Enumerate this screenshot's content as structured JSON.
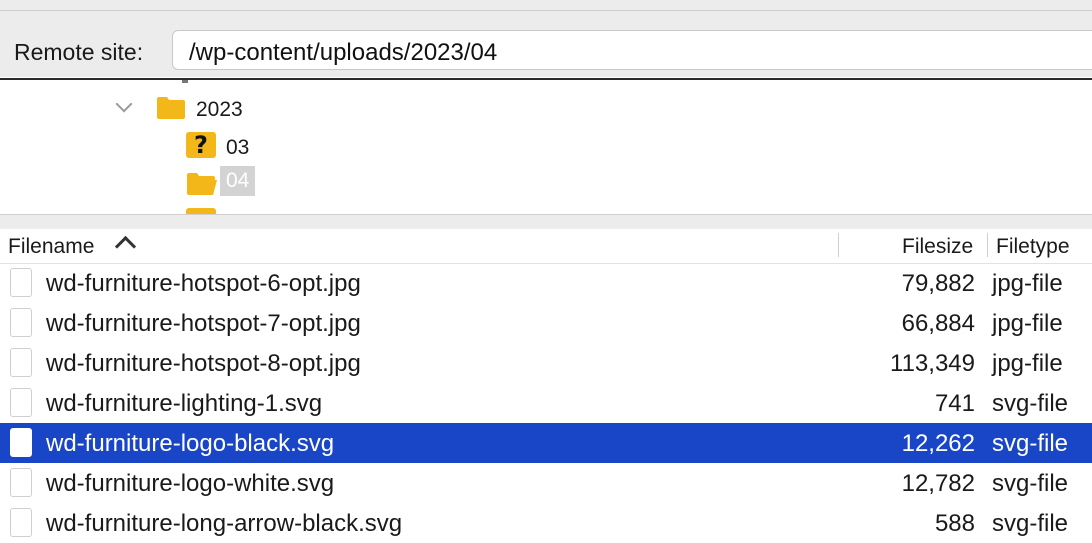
{
  "remote_site": {
    "label": "Remote site:",
    "path": "/wp-content/uploads/2023/04"
  },
  "tree": {
    "items": [
      {
        "label": "2023",
        "icon": "folder-icon",
        "expanded": true
      },
      {
        "label": "03",
        "icon": "unknown-folder-icon"
      },
      {
        "label": "04",
        "icon": "open-folder-icon",
        "selected": true
      }
    ]
  },
  "file_list": {
    "headers": {
      "filename": "Filename",
      "filesize": "Filesize",
      "filetype": "Filetype"
    },
    "sort": {
      "column": "Filename",
      "direction": "ascending"
    },
    "rows": [
      {
        "name": "wd-furniture-hotspot-6-opt.jpg",
        "size": "79,882",
        "type": "jpg-file"
      },
      {
        "name": "wd-furniture-hotspot-7-opt.jpg",
        "size": "66,884",
        "type": "jpg-file"
      },
      {
        "name": "wd-furniture-hotspot-8-opt.jpg",
        "size": "113,349",
        "type": "jpg-file"
      },
      {
        "name": "wd-furniture-lighting-1.svg",
        "size": "741",
        "type": "svg-file"
      },
      {
        "name": "wd-furniture-logo-black.svg",
        "size": "12,262",
        "type": "svg-file",
        "selected": true
      },
      {
        "name": "wd-furniture-logo-white.svg",
        "size": "12,782",
        "type": "svg-file"
      },
      {
        "name": "wd-furniture-long-arrow-black.svg",
        "size": "588",
        "type": "svg-file"
      }
    ]
  },
  "colors": {
    "selection": "#1945c7",
    "folder": "#f3b71a",
    "tree_selection": "#d3d3d3"
  }
}
